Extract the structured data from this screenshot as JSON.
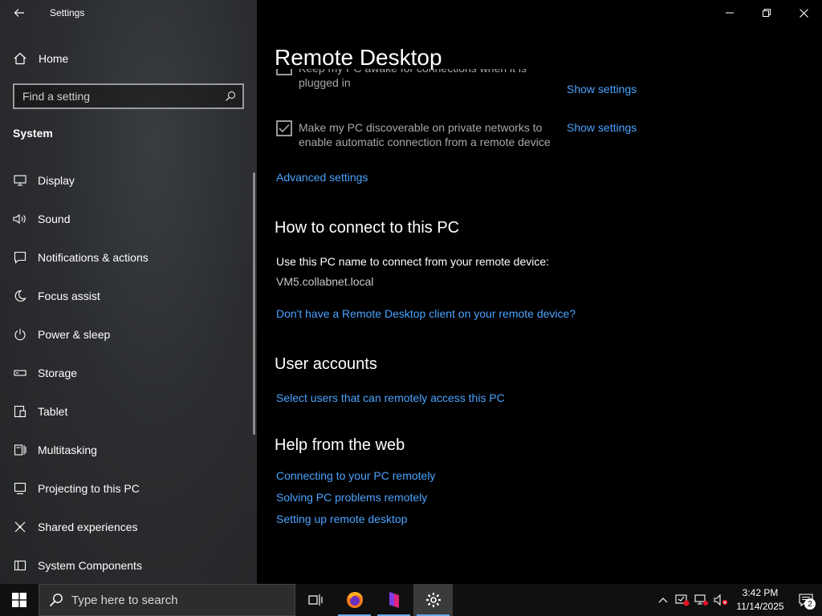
{
  "window": {
    "title": "Settings"
  },
  "sidebar": {
    "home_label": "Home",
    "search_placeholder": "Find a setting",
    "section": "System",
    "items": [
      {
        "label": "Display",
        "icon": "monitor-icon"
      },
      {
        "label": "Sound",
        "icon": "speaker-icon"
      },
      {
        "label": "Notifications & actions",
        "icon": "notification-icon"
      },
      {
        "label": "Focus assist",
        "icon": "moon-icon"
      },
      {
        "label": "Power & sleep",
        "icon": "power-icon"
      },
      {
        "label": "Storage",
        "icon": "storage-icon"
      },
      {
        "label": "Tablet",
        "icon": "tablet-icon"
      },
      {
        "label": "Multitasking",
        "icon": "multitasking-icon"
      },
      {
        "label": "Projecting to this PC",
        "icon": "projector-icon"
      },
      {
        "label": "Shared experiences",
        "icon": "shared-icon"
      },
      {
        "label": "System Components",
        "icon": "components-icon"
      }
    ]
  },
  "main": {
    "title": "Remote Desktop",
    "options": [
      {
        "label": "Keep my PC awake for connections when it is plugged in",
        "checked": false,
        "link": "Show settings"
      },
      {
        "label": "Make my PC discoverable on private networks to enable automatic connection from a remote device",
        "checked": true,
        "link": "Show settings"
      }
    ],
    "advanced_link": "Advanced settings",
    "connect": {
      "heading": "How to connect to this PC",
      "instruction": "Use this PC name to connect from your remote device:",
      "pc_name": "VM5.collabnet.local",
      "client_link": "Don't have a Remote Desktop client on your remote device?"
    },
    "accounts": {
      "heading": "User accounts",
      "link": "Select users that can remotely access this PC"
    },
    "help": {
      "heading": "Help from the web",
      "links": [
        "Connecting to your PC remotely",
        "Solving PC problems remotely",
        "Setting up remote desktop"
      ]
    }
  },
  "taskbar": {
    "search_placeholder": "Type here to search",
    "time": "3:42 PM",
    "date": "11/14/2025",
    "notification_count": "2"
  },
  "colors": {
    "accent_link": "#4aa3ff",
    "taskbar_active_underline": "#6aa9e8"
  }
}
